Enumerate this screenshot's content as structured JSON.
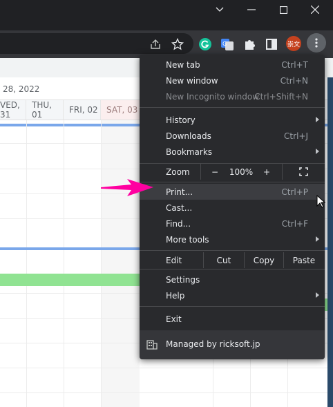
{
  "calendar": {
    "date_fragment": "28, 2022",
    "days": [
      "VED, 31",
      "THU, 01",
      "FRI, 02",
      "SAT, 03"
    ]
  },
  "profile": {
    "avatar_text": "崇文"
  },
  "menu": {
    "new_tab": {
      "label": "New tab",
      "shortcut": "Ctrl+T"
    },
    "new_window": {
      "label": "New window",
      "shortcut": "Ctrl+N"
    },
    "new_incognito": {
      "label": "New Incognito window",
      "shortcut": "Ctrl+Shift+N"
    },
    "history": {
      "label": "History"
    },
    "downloads": {
      "label": "Downloads",
      "shortcut": "Ctrl+J"
    },
    "bookmarks": {
      "label": "Bookmarks"
    },
    "zoom": {
      "label": "Zoom",
      "minus": "−",
      "value": "100%",
      "plus": "+"
    },
    "print": {
      "label": "Print...",
      "shortcut": "Ctrl+P"
    },
    "cast": {
      "label": "Cast..."
    },
    "find": {
      "label": "Find...",
      "shortcut": "Ctrl+F"
    },
    "more_tools": {
      "label": "More tools"
    },
    "edit": {
      "label": "Edit",
      "cut": "Cut",
      "copy": "Copy",
      "paste": "Paste"
    },
    "settings": {
      "label": "Settings"
    },
    "help": {
      "label": "Help"
    },
    "exit": {
      "label": "Exit"
    },
    "managed": {
      "label": "Managed by ricksoft.jp"
    }
  },
  "colors": {
    "menu_bg": "#292a2d",
    "arrow": "#ff00a0",
    "highlight": "#3c3d41"
  }
}
